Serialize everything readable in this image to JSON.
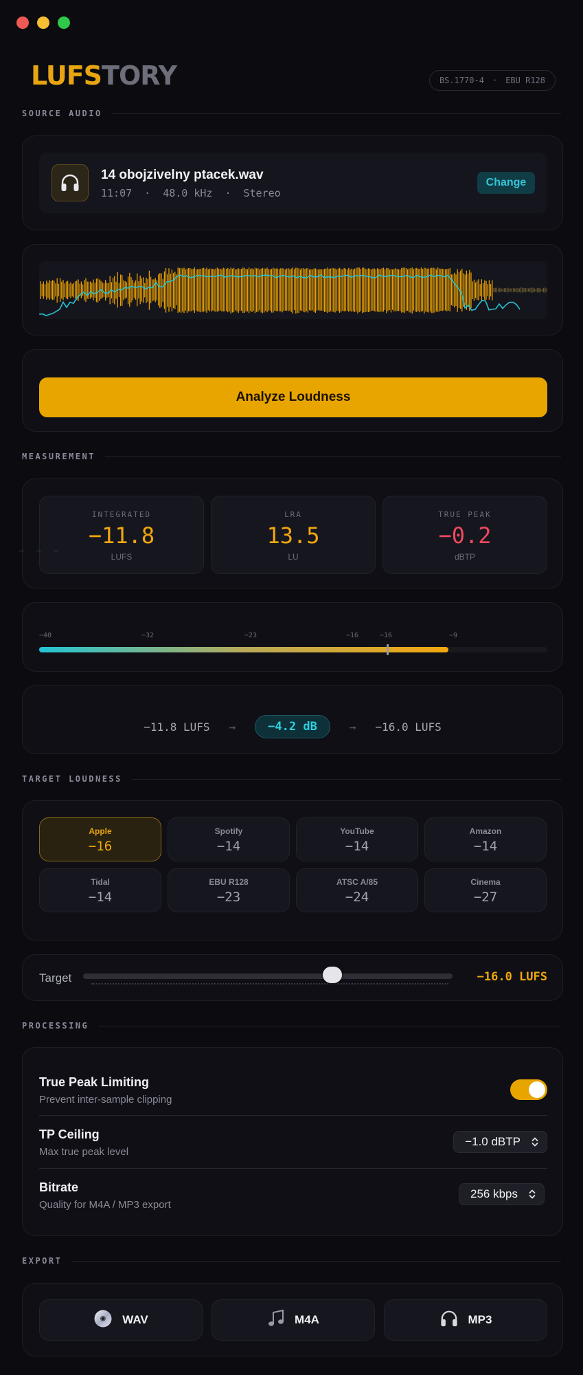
{
  "app": {
    "logo_a": "LUFS",
    "logo_b": "TORY",
    "standards": [
      "BS.1770-4",
      "·",
      "EBU R128"
    ]
  },
  "sections": {
    "source": "SOURCE AUDIO",
    "measurement": "MEASUREMENT",
    "target": "TARGET LOUDNESS",
    "processing": "PROCESSING",
    "export": "EXPORT"
  },
  "file": {
    "icon": "headphones-icon",
    "name": "14 obojzivelny ptacek.wav",
    "duration": "11:07",
    "sep": "·",
    "sample_rate": "48.0 kHz",
    "channels": "Stereo",
    "change_label": "Change"
  },
  "analyze": {
    "label": "Analyze Loudness"
  },
  "metrics": {
    "integrated": {
      "label": "INTEGRATED",
      "value": "−11.8",
      "unit": "LUFS",
      "color": "#f2a70f"
    },
    "lra": {
      "label": "LRA",
      "value": "13.5",
      "unit": "LU",
      "color": "#f2a70f"
    },
    "true_peak": {
      "label": "TRUE PEAK",
      "value": "−0.2",
      "unit": "dBTP",
      "color": "#ee4a5e"
    },
    "left_dash": "– – –"
  },
  "meter": {
    "ticks": [
      "−40",
      "−32",
      "−23",
      "−16",
      "−16",
      "−9"
    ],
    "level_fraction": 0.805,
    "marker_fraction": 0.685
  },
  "gain": {
    "from": "−11.8 LUFS",
    "arrow": "→",
    "delta": "−4.2 dB",
    "to": "−16.0 LUFS"
  },
  "presets": [
    {
      "name": "Apple",
      "value": "−16",
      "active": true
    },
    {
      "name": "Spotify",
      "value": "−14",
      "active": false
    },
    {
      "name": "YouTube",
      "value": "−14",
      "active": false
    },
    {
      "name": "Amazon",
      "value": "−14",
      "active": false
    },
    {
      "name": "Tidal",
      "value": "−14",
      "active": false
    },
    {
      "name": "EBU R128",
      "value": "−23",
      "active": false
    },
    {
      "name": "ATSC A/85",
      "value": "−24",
      "active": false
    },
    {
      "name": "Cinema",
      "value": "−27",
      "active": false
    }
  ],
  "target": {
    "label": "Target",
    "value": "−16.0 LUFS",
    "slider_fraction": 0.675
  },
  "processing": {
    "tp_limit": {
      "title": "True Peak Limiting",
      "subtitle": "Prevent inter-sample clipping",
      "enabled": true
    },
    "tp_ceiling": {
      "title": "TP Ceiling",
      "subtitle": "Max true peak level",
      "value": "−1.0 dBTP"
    },
    "bitrate": {
      "title": "Bitrate",
      "subtitle": "Quality for M4A / MP3 export",
      "value": "256 kbps"
    }
  },
  "export": [
    {
      "label": "WAV",
      "icon": "disc-icon"
    },
    {
      "label": "M4A",
      "icon": "music-note-icon"
    },
    {
      "label": "MP3",
      "icon": "headphones-icon"
    }
  ],
  "colors": {
    "accent": "#e8a500",
    "cyan": "#2fd0e0",
    "danger": "#ee4a5e",
    "background": "#0b0b10"
  }
}
